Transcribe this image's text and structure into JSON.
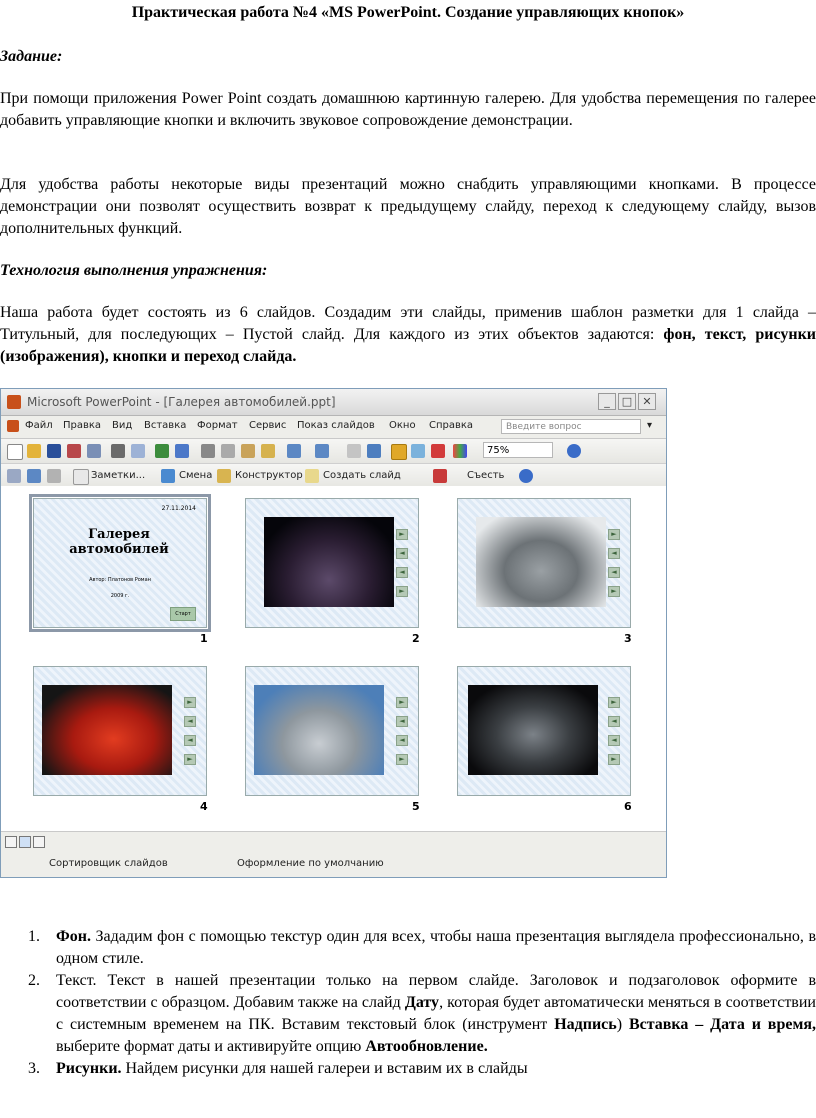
{
  "title": "Практическая работа №4 «MS PowerPoint. Создание управляющих кнопок»",
  "task_heading": "Задание:",
  "task_p1": "При помощи приложения Power Point создать домашнюю картинную галерею. Для удобства перемещения по галерее добавить управляющие кнопки и включить звуковое сопровождение демонстрации.",
  "task_p2": "Для удобства работы некоторые виды презентаций можно снабдить управляющими кнопками. В процессе демонстрации они позволят осуществить возврат к предыдущему слайду, переход к следующему слайду, вызов дополнительных функций.",
  "tech_heading": "Технология выполнения упражнения:",
  "tech_p_text": "Наша работа будет состоять из 6 слайдов. Создадим эти слайды, применив шаблон разметки для 1 слайда – Титульный, для последующих – Пустой слайд. Для каждого из этих объектов задаются: ",
  "tech_p_bold": "фон, текст, рисунки (изображения), кнопки и переход слайда.",
  "screenshot": {
    "window_title": "Microsoft PowerPoint - [Галерея автомобилей.ppt]",
    "menu": [
      "Файл",
      "Правка",
      "Вид",
      "Вставка",
      "Формат",
      "Сервис",
      "Показ слайдов",
      "Окно",
      "Справка"
    ],
    "help_placeholder": "Введите вопрос",
    "zoom": "75%",
    "toolbar2": [
      "Заметки...",
      "Смена",
      "Конструктор",
      "Создать слайд",
      "Съесть"
    ],
    "title_slide": {
      "date": "27.11.2014",
      "heading": "Галерея автомобилей",
      "author": "Автор: Платонов Роман",
      "year": "2009 г.",
      "button": "Старт"
    },
    "slide_numbers": [
      "1",
      "2",
      "3",
      "4",
      "5",
      "6"
    ],
    "nav_arrows": [
      "►",
      "◄",
      "◄",
      "►"
    ],
    "status_left": "Сортировщик слайдов",
    "status_mid": "Оформление по умолчанию",
    "accent_color": "#c8501a"
  },
  "list": [
    {
      "num": "1.",
      "bold": "Фон.",
      "text": " Зададим фон с помощью текстур один для всех, чтобы наша презентация выглядела профессионально, в одном стиле."
    },
    {
      "num": "2.",
      "text_a": "Текст. Текст в нашей презентации только на первом слайде. Заголовок и подзаголовок оформите в соответствии с образцом. Добавим также на слайд ",
      "bold_a": "Дату",
      "text_b": ", которая будет автоматически меняться в соответствии с системным временем на ПК. Вставим текстовый блок (инструмент ",
      "bold_b": "Надпись",
      "text_c": ") ",
      "bold_c": "Вставка – Дата и время,",
      "text_d": " выберите формат даты и активируйте опцию ",
      "bold_d": "Автообновление."
    },
    {
      "num": "3.",
      "bold": "Рисунки.",
      "text": " Найдем рисунки для нашей галереи и вставим их в слайды"
    }
  ]
}
